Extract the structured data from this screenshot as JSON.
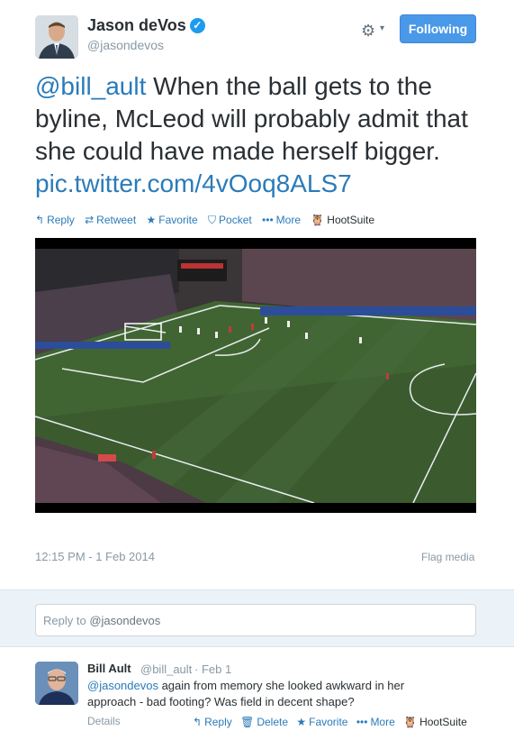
{
  "author": {
    "name": "Jason deVos",
    "handle": "@jasondevos",
    "following_label": "Following"
  },
  "tweet": {
    "mention": "@bill_ault",
    "text": " When the ball gets to the byline, McLeod will probably admit that she could have made herself bigger. ",
    "link": "pic.twitter.com/4vOoq8ALS7",
    "timestamp": "12:15 PM - 1 Feb 2014",
    "flag_label": "Flag media"
  },
  "actions": {
    "reply": "Reply",
    "retweet": "Retweet",
    "favorite": "Favorite",
    "pocket": "Pocket",
    "more": "More",
    "hootsuite": "HootSuite"
  },
  "reply_box": {
    "prefix": "Reply to ",
    "handle": "@jasondevos"
  },
  "reply_tweet": {
    "name": "Bill Ault",
    "handle": "@bill_ault",
    "date": "· Feb 1",
    "mention": "@jasondevos",
    "text": " again from memory she looked awkward in her approach - bad footing? Was field in decent shape?",
    "details": "Details",
    "actions": {
      "reply": "Reply",
      "delete": "Delete",
      "favorite": "Favorite",
      "more": "More",
      "hootsuite": "HootSuite"
    }
  },
  "colors": {
    "link": "#2b7bb9",
    "follow_button": "#4a99e9",
    "muted": "#8899a6"
  }
}
